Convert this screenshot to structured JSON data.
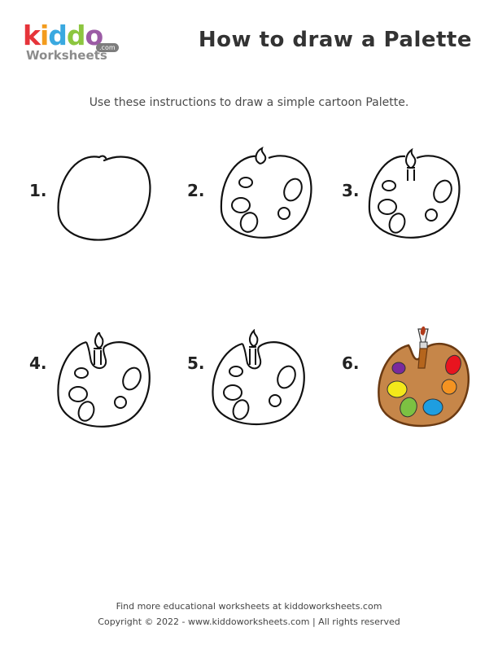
{
  "logo": {
    "brand": "kiddo",
    "sub": "Worksheets",
    "tld": ".com"
  },
  "title": "How to draw a Palette",
  "instructions": "Use these instructions to draw a simple cartoon Palette.",
  "steps": [
    {
      "number": "1."
    },
    {
      "number": "2."
    },
    {
      "number": "3."
    },
    {
      "number": "4."
    },
    {
      "number": "5."
    },
    {
      "number": "6."
    }
  ],
  "colors": {
    "palette_fill": "#c68649",
    "palette_outline": "#6b3a12",
    "paint": [
      "#7a2a9c",
      "#e8141f",
      "#f3e81a",
      "#f49321",
      "#7cc142",
      "#1e9ee0"
    ],
    "brush_handle": "#b5651d",
    "logo_letters": [
      "#e6343a",
      "#f39c1e",
      "#3aa9e0",
      "#8cc63f",
      "#9b5ba5"
    ]
  },
  "footer": {
    "line1": "Find more educational worksheets at kiddoworksheets.com",
    "line2": "Copyright © 2022 - www.kiddoworksheets.com  |  All rights reserved"
  }
}
